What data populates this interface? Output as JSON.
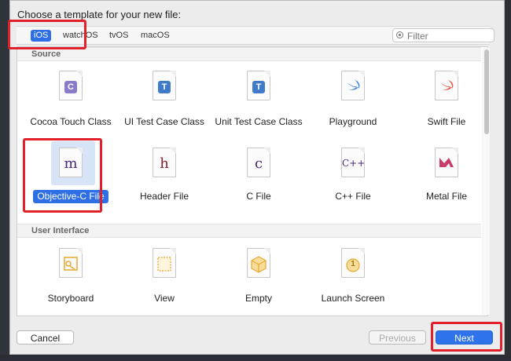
{
  "dialog": {
    "prompt": "Choose a template for your new file:",
    "tabs": [
      {
        "label": "iOS",
        "selected": true
      },
      {
        "label": "watchOS",
        "selected": false
      },
      {
        "label": "tvOS",
        "selected": false
      },
      {
        "label": "macOS",
        "selected": false
      }
    ],
    "filter_placeholder": "Filter",
    "sections": [
      {
        "title": "Source",
        "items": [
          {
            "label": "Cocoa Touch Class",
            "glyph": "C",
            "glyph_color": "#8b79c9"
          },
          {
            "label": "UI Test Case Class",
            "glyph": "T",
            "glyph_color": "#3f7bc8"
          },
          {
            "label": "Unit Test Case Class",
            "glyph": "T",
            "glyph_color": "#3f7bc8"
          },
          {
            "label": "Playground",
            "glyph": "swift-bird-icon",
            "glyph_color": "#3b86e6"
          },
          {
            "label": "Swift File",
            "glyph": "swift-bird-icon",
            "glyph_color": "#f05138"
          },
          {
            "label": "Objective-C File",
            "glyph": "m",
            "glyph_color": "#4a2a7a",
            "selected": true
          },
          {
            "label": "Header File",
            "glyph": "h",
            "glyph_color": "#8b1f2e"
          },
          {
            "label": "C File",
            "glyph": "c",
            "glyph_color": "#4a2a7a"
          },
          {
            "label": "C++ File",
            "glyph": "C++",
            "glyph_color": "#4a2a7a"
          },
          {
            "label": "Metal File",
            "glyph": "metal-icon",
            "glyph_color": "#c83a6a"
          }
        ]
      },
      {
        "title": "User Interface",
        "items": [
          {
            "label": "Storyboard",
            "glyph": "storyboard-icon",
            "glyph_color": "#e7a931"
          },
          {
            "label": "View",
            "glyph": "view-icon",
            "glyph_color": "#e7a931"
          },
          {
            "label": "Empty",
            "glyph": "cube-icon",
            "glyph_color": "#e7a931"
          },
          {
            "label": "Launch Screen",
            "glyph": "1",
            "glyph_color": "#e7a931"
          }
        ]
      }
    ],
    "buttons": {
      "cancel": "Cancel",
      "previous": "Previous",
      "next": "Next"
    }
  }
}
